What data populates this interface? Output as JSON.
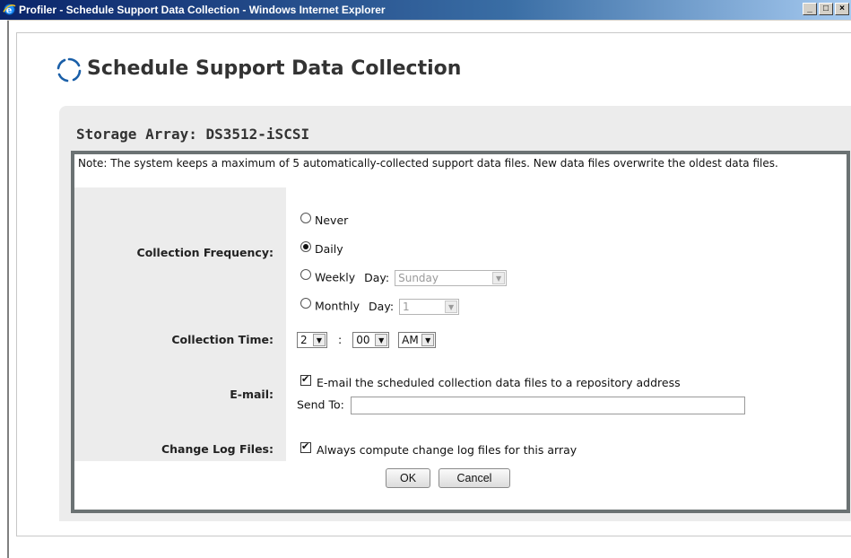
{
  "window": {
    "title": "Profiler - Schedule Support Data Collection - Windows Internet Explorer",
    "minimize": "_",
    "maximize": "□",
    "close": "×"
  },
  "dialog": {
    "title": "Schedule Support Data Collection",
    "array_title": "Storage Array: DS3512-iSCSI",
    "note": "Note: The system keeps a maximum of 5 automatically-collected support data files. New data files overwrite the oldest data files."
  },
  "frequency": {
    "label": "Collection Frequency:",
    "never": "Never",
    "daily": "Daily",
    "weekly": "Weekly",
    "monthly": "Monthly",
    "day_label": "Day:",
    "weekly_day": "Sunday",
    "monthly_day": "1",
    "selected": "daily"
  },
  "time": {
    "label": "Collection Time:",
    "hour": "2",
    "separator": ":",
    "minute": "00",
    "ampm": "AM"
  },
  "email": {
    "label": "E-mail:",
    "checkbox_label": "E-mail the scheduled collection data files to a repository address",
    "checked": true,
    "send_to_label": "Send To:",
    "send_to_value": ""
  },
  "changelog": {
    "label": "Change Log Files:",
    "checkbox_label": "Always compute change log files for this array",
    "checked": true
  },
  "buttons": {
    "ok": "OK",
    "cancel": "Cancel"
  },
  "icons": {
    "browser": "ie-icon",
    "dialog": "spinner-icon",
    "dropdown": "chevron-down-icon"
  }
}
